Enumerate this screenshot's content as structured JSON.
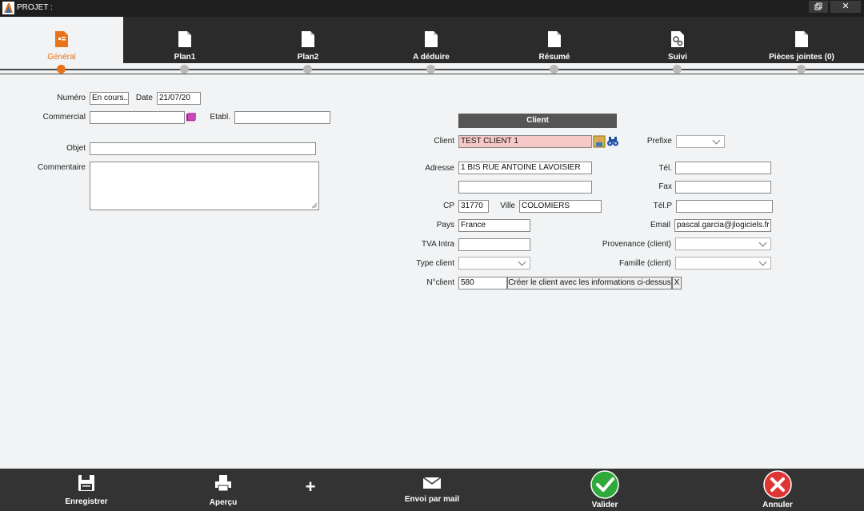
{
  "window": {
    "title": "PROJET :"
  },
  "tabs": [
    {
      "label": "Général",
      "icon": "document-edit-icon",
      "active": true
    },
    {
      "label": "Plan1",
      "icon": "document-icon"
    },
    {
      "label": "Plan2",
      "icon": "document-icon"
    },
    {
      "label": "A déduire",
      "icon": "document-icon"
    },
    {
      "label": "Résumé",
      "icon": "document-icon"
    },
    {
      "label": "Suivi",
      "icon": "document-gears-icon"
    },
    {
      "label": "Pièces jointes (0)",
      "icon": "document-icon"
    }
  ],
  "form": {
    "numero_label": "Numéro",
    "numero_value": "En cours...",
    "date_label": "Date",
    "date_value": "21/07/20",
    "commercial_label": "Commercial",
    "commercial_value": "",
    "etabl_label": "Etabl.",
    "etabl_value": "",
    "objet_label": "Objet",
    "objet_value": "",
    "commentaire_label": "Commentaire",
    "commentaire_value": ""
  },
  "client": {
    "section_title": "Client",
    "client_label": "Client",
    "client_value": "TEST CLIENT 1",
    "prefixe_label": "Prefixe",
    "prefixe_value": "",
    "adresse_label": "Adresse",
    "adresse1_value": "1 BIS RUE ANTOINE LAVOISIER",
    "adresse2_value": "",
    "tel_label": "Tél.",
    "tel_value": "",
    "fax_label": "Fax",
    "fax_value": "",
    "cp_label": "CP",
    "cp_value": "31770",
    "ville_label": "Ville",
    "ville_value": "COLOMIERS",
    "telp_label": "Tél.P",
    "telp_value": "",
    "pays_label": "Pays",
    "pays_value": "France",
    "email_label": "Email",
    "email_value": "pascal.garcia@jlogiciels.fr",
    "tva_label": "TVA Intra",
    "tva_value": "",
    "provenance_label": "Provenance (client)",
    "provenance_value": "",
    "type_label": "Type client",
    "type_value": "",
    "famille_label": "Famille (client)",
    "famille_value": "",
    "nclient_label": "N°client",
    "nclient_value": "580",
    "create_button": "Créer le client avec les informations ci-dessus",
    "close_button": "X"
  },
  "toolbar": {
    "save": "Enregistrer",
    "preview": "Aperçu",
    "add": "+",
    "mail": "Envoi par mail",
    "validate": "Valider",
    "cancel": "Annuler"
  },
  "colors": {
    "accent": "#e8731a",
    "dark": "#2b2b2b",
    "client_pink": "#f6c8c8",
    "validate_green": "#2eaa3a",
    "cancel_red": "#e03535"
  }
}
